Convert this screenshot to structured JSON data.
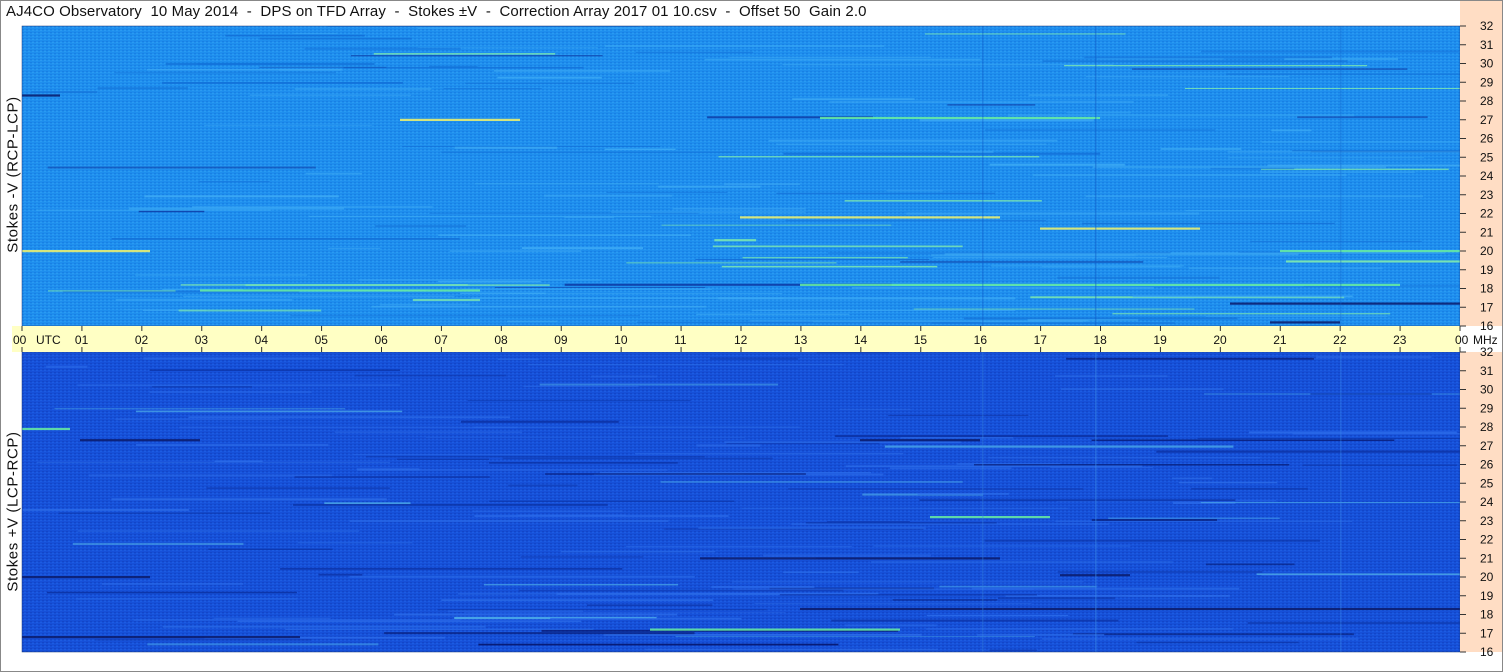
{
  "title": "AJ4CO Observatory  10 May 2014  -  DPS on TFD Array  -  Stokes ±V  -  Correction Array 2017 01 10.csv  -  Offset 50  Gain 2.0",
  "colors": {
    "top_base": "#1E8EEE",
    "bottom_base": "#1650D8",
    "time_strip": "#FFFFC4",
    "freq_strip": "#FFDDC4",
    "highlight_green": "#6AF0A0",
    "highlight_yellow": "#F4F46A",
    "dark_line": "#0A1A6A"
  },
  "chart_data": [
    {
      "type": "heatmap",
      "name": "Stokes -V (RCP-LCP)",
      "ylabel": "Stokes -V  (RCP-LCP)",
      "x_unit": "UTC",
      "y_unit": "MHz",
      "xlim": [
        0,
        24
      ],
      "ylim": [
        16,
        32
      ],
      "x_ticks": [
        "00",
        "01",
        "02",
        "03",
        "04",
        "05",
        "06",
        "07",
        "08",
        "09",
        "10",
        "11",
        "12",
        "13",
        "14",
        "15",
        "16",
        "17",
        "18",
        "19",
        "20",
        "21",
        "22",
        "23",
        "00"
      ],
      "y_ticks": [
        "16",
        "17",
        "18",
        "19",
        "20",
        "21",
        "22",
        "23",
        "24",
        "25",
        "26",
        "27",
        "28",
        "29",
        "30",
        "31",
        "32"
      ]
    },
    {
      "type": "heatmap",
      "name": "Stokes +V (LCP-RCP)",
      "ylabel": "Stokes +V  (LCP-RCP)",
      "x_unit": "UTC",
      "y_unit": "MHz",
      "xlim": [
        0,
        24
      ],
      "ylim": [
        16,
        32
      ],
      "x_ticks": [
        "00",
        "01",
        "02",
        "03",
        "04",
        "05",
        "06",
        "07",
        "08",
        "09",
        "10",
        "11",
        "12",
        "13",
        "14",
        "15",
        "16",
        "17",
        "18",
        "19",
        "20",
        "21",
        "22",
        "23",
        "00"
      ],
      "y_ticks": [
        "16",
        "17",
        "18",
        "19",
        "20",
        "21",
        "22",
        "23",
        "24",
        "25",
        "26",
        "27",
        "28",
        "29",
        "30",
        "31",
        "32"
      ]
    }
  ],
  "time_axis": {
    "utc_label": "UTC",
    "mhz_label": "MHz"
  }
}
